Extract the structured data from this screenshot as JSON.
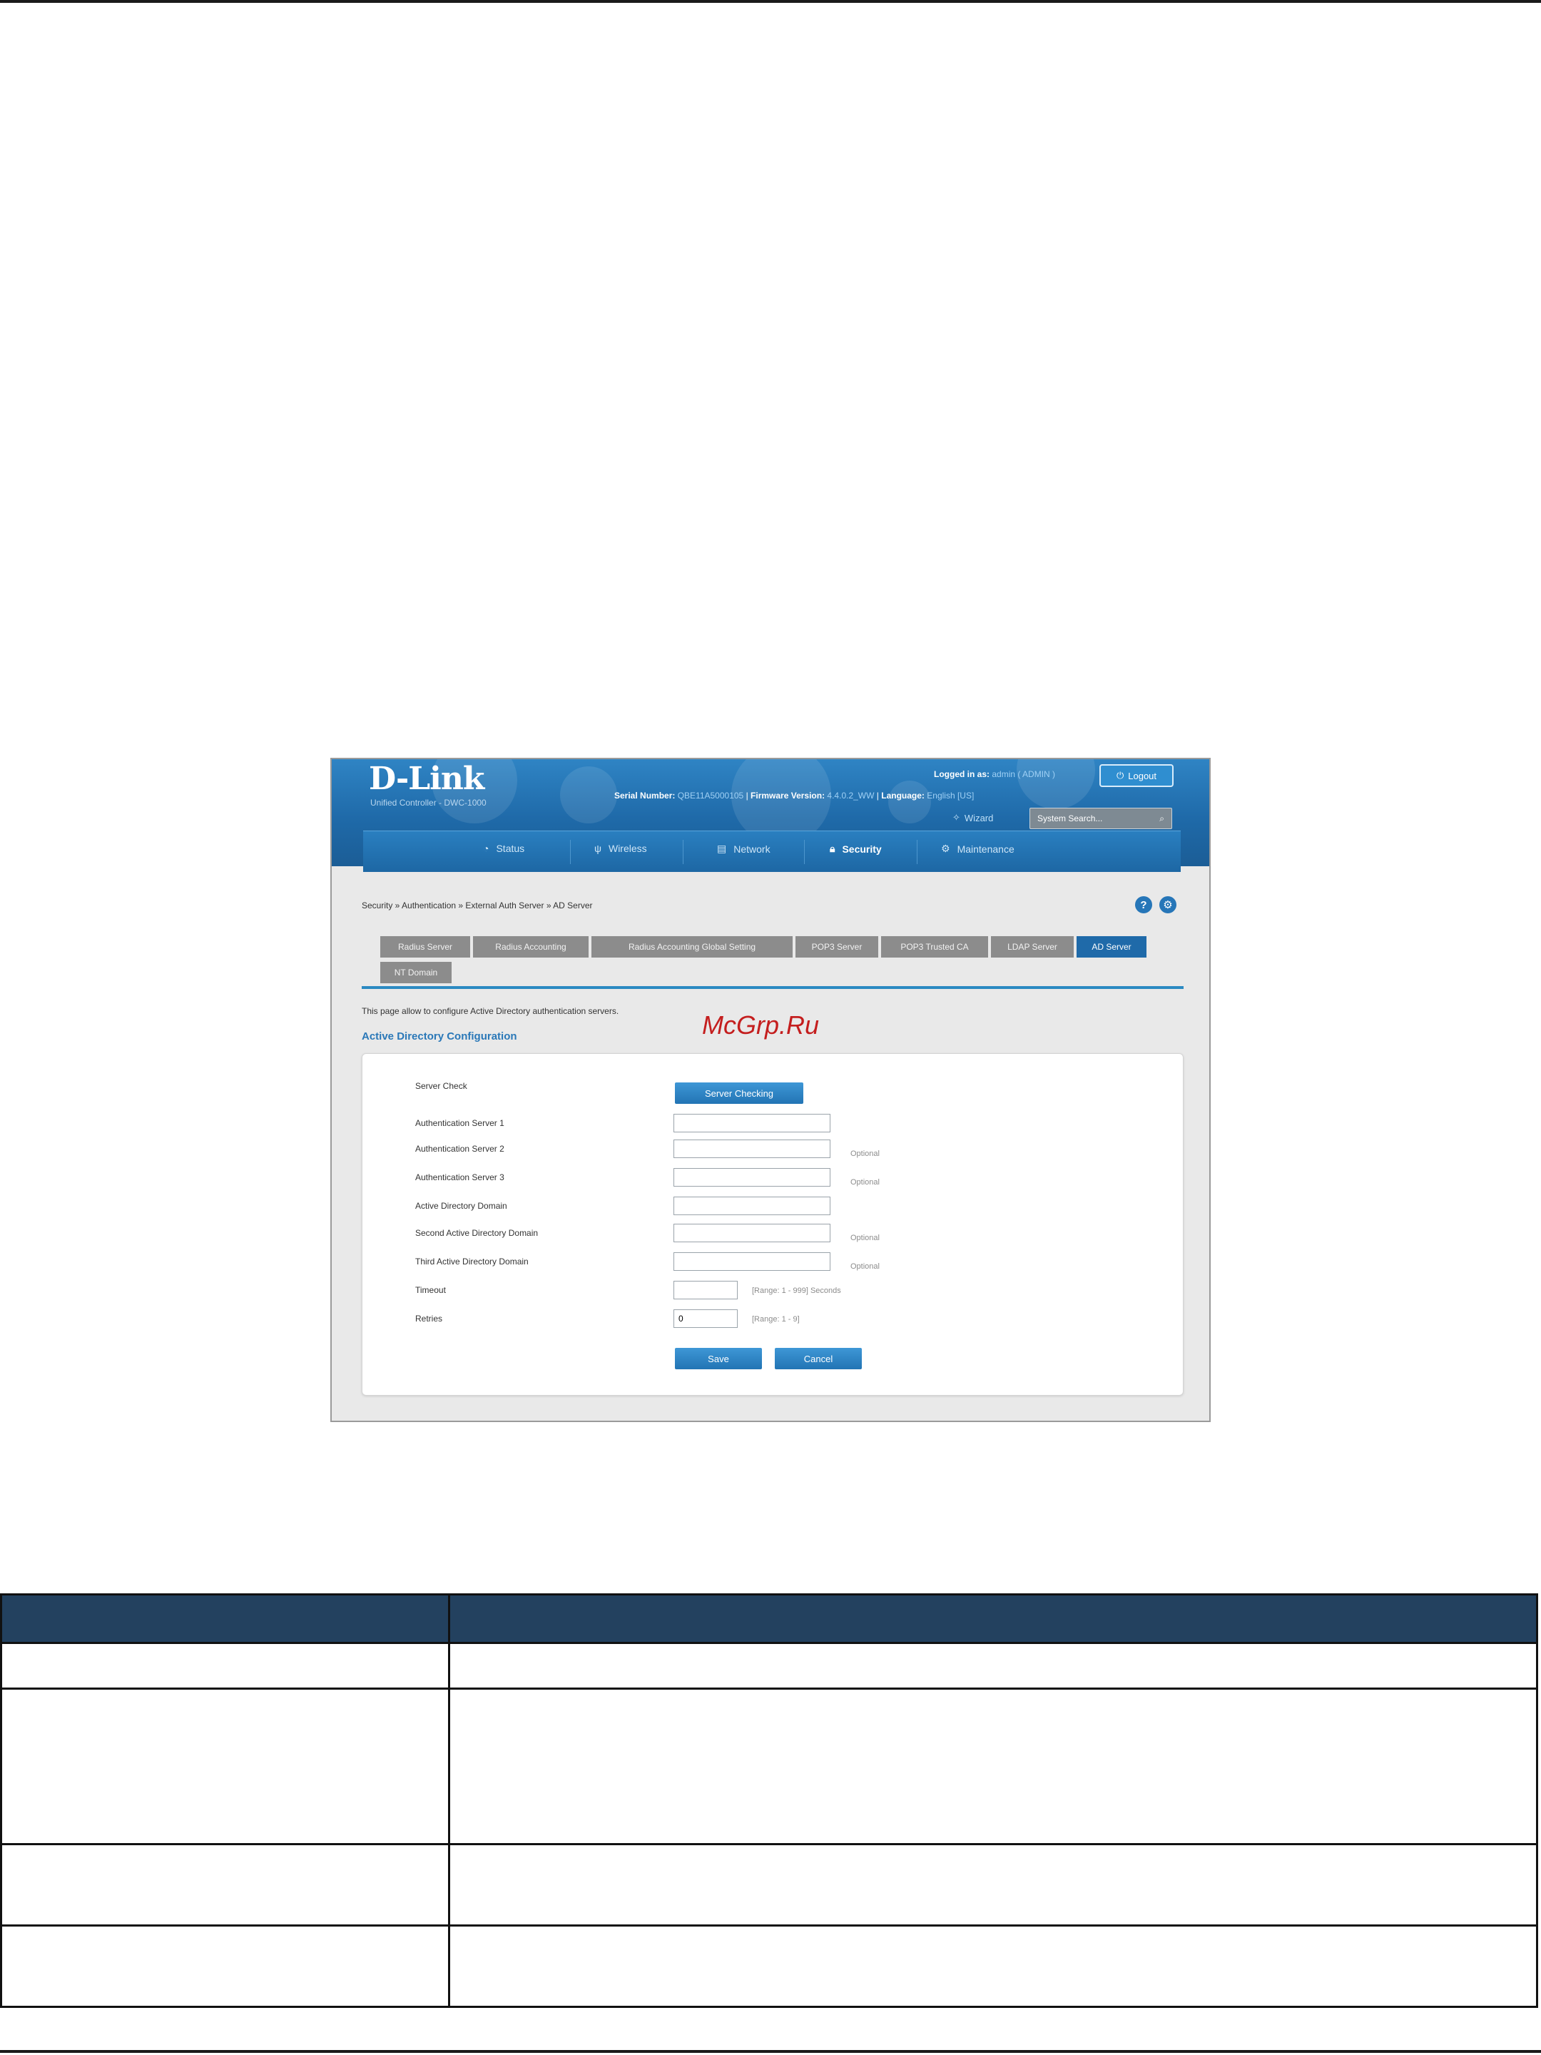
{
  "screenshot": {
    "header": {
      "brand": "D-Link",
      "subtitle": "Unified Controller - DWC-1000",
      "logged_in_label": "Logged in as:",
      "logged_in_value": "admin ( ADMIN )",
      "logout_label": "Logout",
      "serial_label": "Serial Number:",
      "serial_value": "QBE11A5000105",
      "firmware_label": "Firmware Version:",
      "firmware_value": "4.4.0.2_WW",
      "language_label": "Language:",
      "language_value": "English [US]",
      "wizard_label": "Wizard",
      "search_placeholder": "System Search..."
    },
    "nav": [
      {
        "label": "Status",
        "icon": "gauge-icon"
      },
      {
        "label": "Wireless",
        "icon": "antenna-icon"
      },
      {
        "label": "Network",
        "icon": "network-icon"
      },
      {
        "label": "Security",
        "icon": "lock-icon"
      },
      {
        "label": "Maintenance",
        "icon": "gear-icon"
      }
    ],
    "breadcrumb": "Security  »  Authentication  »  External Auth Server  »  AD Server",
    "help_icon": "?",
    "tabs": [
      {
        "label": "Radius Server"
      },
      {
        "label": "Radius Accounting"
      },
      {
        "label": "Radius Accounting Global Setting"
      },
      {
        "label": "POP3 Server"
      },
      {
        "label": "POP3 Trusted CA"
      },
      {
        "label": "LDAP Server"
      },
      {
        "label": "AD Server",
        "active": true
      },
      {
        "label": "NT Domain"
      }
    ],
    "intro": "This page allow to configure Active Directory authentication servers.",
    "section_title": "Active Directory Configuration",
    "form": {
      "server_check_label": "Server Check",
      "server_check_button": "Server Checking",
      "fields": [
        {
          "label": "Authentication Server 1",
          "value": "",
          "hint": ""
        },
        {
          "label": "Authentication Server 2",
          "value": "",
          "hint": "Optional"
        },
        {
          "label": "Authentication Server 3",
          "value": "",
          "hint": "Optional"
        },
        {
          "label": "Active Directory Domain",
          "value": "",
          "hint": ""
        },
        {
          "label": "Second Active Directory Domain",
          "value": "",
          "hint": "Optional"
        },
        {
          "label": "Third Active Directory Domain",
          "value": "",
          "hint": "Optional"
        },
        {
          "label": "Timeout",
          "value": "",
          "hint": "[Range: 1 - 999] Seconds"
        },
        {
          "label": "Retries",
          "value": "0",
          "hint": "[Range: 1 - 9]"
        }
      ],
      "save_button": "Save",
      "cancel_button": "Cancel"
    }
  },
  "watermark": "McGrp.Ru",
  "table": {
    "headers": [
      "",
      ""
    ],
    "rows": [
      [
        "",
        ""
      ],
      [
        "",
        ""
      ],
      [
        "",
        ""
      ],
      [
        "",
        ""
      ]
    ]
  }
}
